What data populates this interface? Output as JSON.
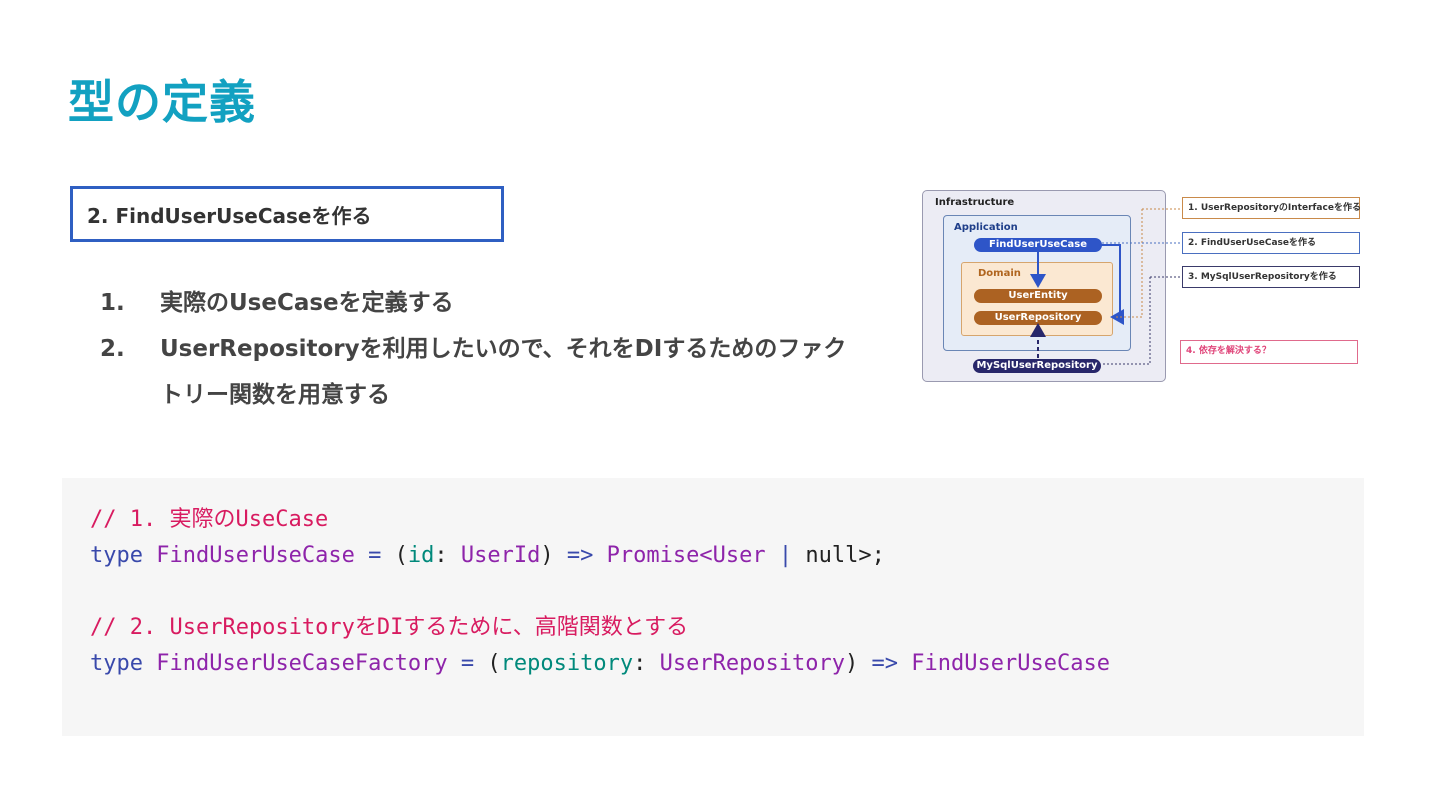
{
  "title": "型の定義",
  "step_box": "2. FindUserUseCaseを作る",
  "steps": [
    {
      "num": "1.",
      "text": "実際のUseCaseを定義する"
    },
    {
      "num": "2.",
      "text": "UserRepositoryを利用したいので、それをDIするためのファクトリー関数を用意する"
    }
  ],
  "diagram": {
    "infrastructure": "Infrastructure",
    "application": "Application",
    "domain": "Domain",
    "find_use_case": "FindUserUseCase",
    "user_entity": "UserEntity",
    "user_repository": "UserRepository",
    "mysql_repository": "MySqlUserRepository",
    "notes": [
      "1. UserRepositoryのInterfaceを作る",
      "2. FindUserUseCaseを作る",
      "3. MySqlUserRepositoryを作る",
      "4. 依存を解決する？"
    ],
    "colors": {
      "note1": "#c98a4a",
      "note2": "#4a6fc0",
      "note3": "#3a3a6a",
      "note4": "#e06a8c"
    }
  },
  "code": {
    "comment1": "// 1. 実際のUseCase",
    "line2": {
      "kw": "type",
      "name": "FindUserUseCase",
      "eq": "=",
      "open": "(",
      "param": "id",
      "colon": ":",
      "ptype": "UserId",
      "close": ")",
      "arrow": "=>",
      "ret": "Promise<User",
      "bar": "|",
      "rest": "null>;"
    },
    "comment2": "// 2. UserRepositoryをDIするために、高階関数とする",
    "line4": {
      "kw": "type",
      "name": "FindUserUseCaseFactory",
      "eq": "=",
      "open": "(",
      "param": "repository",
      "colon": ":",
      "ptype": "UserRepository",
      "close": ")",
      "arrow": "=>",
      "ret": "FindUserUseCase"
    }
  }
}
